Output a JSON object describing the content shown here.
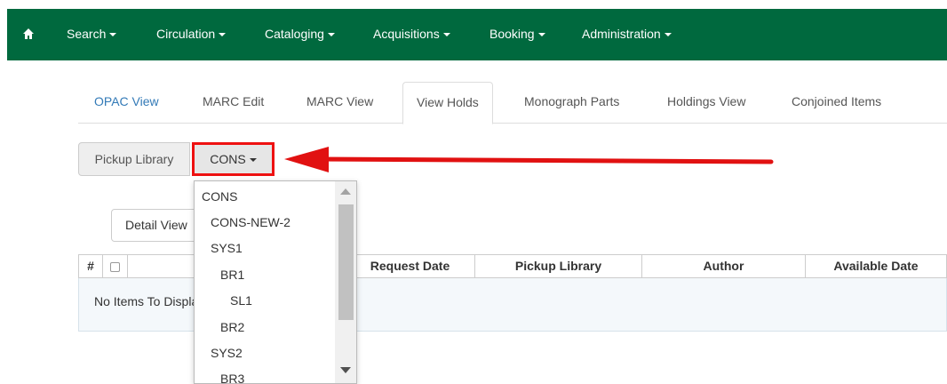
{
  "navbar": {
    "color": "#00693e",
    "home_icon": "home-icon",
    "items": [
      {
        "label": "Search"
      },
      {
        "label": "Circulation"
      },
      {
        "label": "Cataloging"
      },
      {
        "label": "Acquisitions"
      },
      {
        "label": "Booking"
      },
      {
        "label": "Administration"
      }
    ]
  },
  "tabs": [
    {
      "label": "OPAC View"
    },
    {
      "label": "MARC Edit"
    },
    {
      "label": "MARC View"
    },
    {
      "label": "View Holds",
      "active": true
    },
    {
      "label": "Monograph Parts"
    },
    {
      "label": "Holdings View"
    },
    {
      "label": "Conjoined Items"
    }
  ],
  "pickup": {
    "label": "Pickup Library",
    "selected": "CONS",
    "highlight_color": "#e11111"
  },
  "detail_button": {
    "label": "Detail View"
  },
  "grid": {
    "columns": [
      "#",
      "",
      "",
      "Request Date",
      "Pickup Library",
      "Author",
      "Available Date"
    ],
    "empty_text": "No Items To Display"
  },
  "dropdown": {
    "options": [
      "CONS",
      "CONS-NEW-2",
      "SYS1",
      "BR1",
      "SL1",
      "BR2",
      "SYS2",
      "BR3"
    ]
  }
}
